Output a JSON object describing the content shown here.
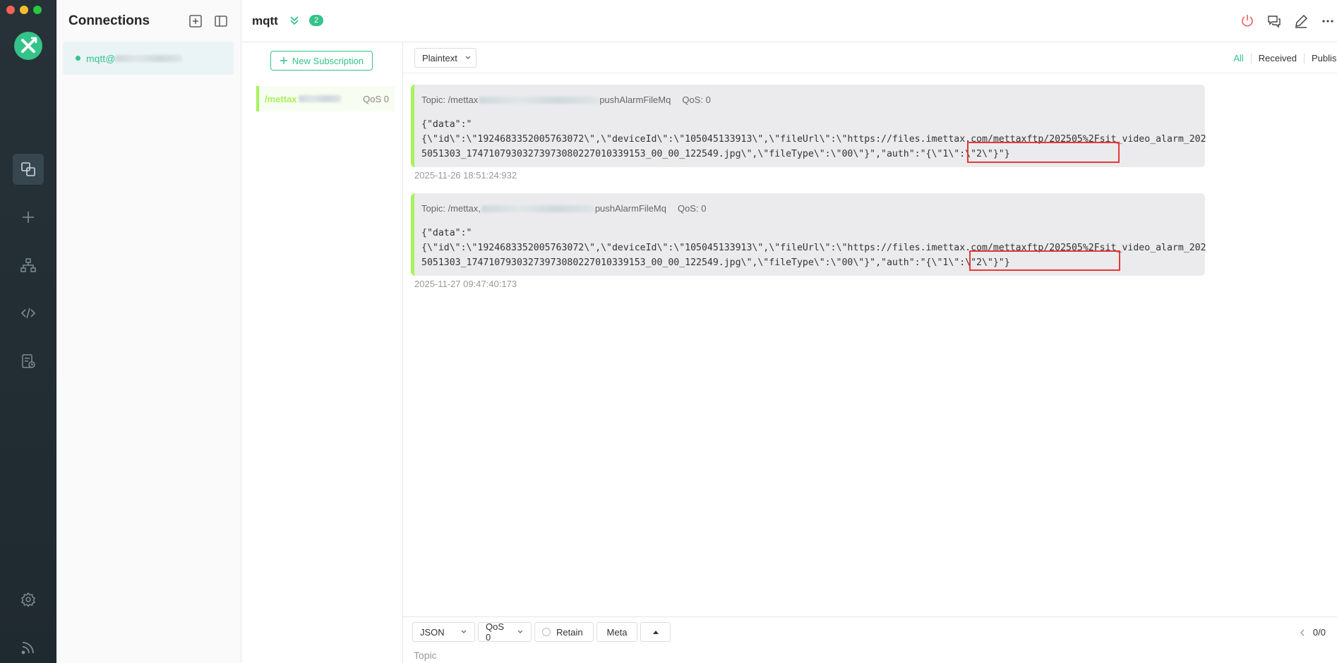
{
  "window": {
    "traffic_lights": [
      "#fe5f57",
      "#febc2e",
      "#28c840"
    ]
  },
  "colors": {
    "accent": "#34c388",
    "topic_color": "#a7f25a",
    "highlight": "#e53935"
  },
  "rail": {
    "items": [
      {
        "icon": "connections-icon",
        "active": true
      },
      {
        "icon": "plus-icon",
        "active": false
      },
      {
        "icon": "topology-icon",
        "active": false
      },
      {
        "icon": "code-icon",
        "active": false
      },
      {
        "icon": "log-icon",
        "active": false
      }
    ],
    "bottom": [
      {
        "icon": "gear-icon"
      },
      {
        "icon": "feed-icon"
      }
    ]
  },
  "connections": {
    "title": "Connections",
    "items": [
      {
        "name": "mqtt@",
        "status": "connected"
      }
    ]
  },
  "header": {
    "title": "mqtt",
    "badge": "2",
    "actions": [
      "power-icon",
      "chat-icon",
      "edit-icon",
      "more-icon"
    ]
  },
  "subscriptions": {
    "new_button": "New Subscription",
    "items": [
      {
        "topic": "/mettax",
        "qos": "QoS 0"
      }
    ]
  },
  "toolbar": {
    "format": "Plaintext",
    "filters": [
      "All",
      "Received",
      "Published"
    ],
    "active_filter": "All"
  },
  "messages": [
    {
      "topic_prefix": "Topic: /mettax",
      "topic_suffix": "pushAlarmFileMq",
      "qos": "QoS: 0",
      "payload": "{\"data\":\"\n{\\\"id\\\":\\\"1924683352005763072\\\",\\\"deviceId\\\":\\\"105045133913\\\",\\\"fileUrl\\\":\\\"https://files.imettax.com/mettaxftp/202505%2Fsit_video_alarm_2025051303_17471079303273973080227010339153_00_00_122549.jpg\\\",\\\"fileType\\\":\\\"00\\\"}\",\"auth\":\"{\\\"1\\\":\\\"2\\\"}\"}",
      "time": "2025-11-26 18:51:24:932"
    },
    {
      "topic_prefix": "Topic: /mettax,",
      "topic_suffix": "pushAlarmFileMq",
      "qos": "QoS: 0",
      "payload": "{\"data\":\"\n{\\\"id\\\":\\\"1924683352005763072\\\",\\\"deviceId\\\":\\\"105045133913\\\",\\\"fileUrl\\\":\\\"https://files.imettax.com/mettaxftp/202505%2Fsit_video_alarm_2025051303_17471079303273973080227010339153_00_00_122549.jpg\\\",\\\"fileType\\\":\\\"00\\\"}\",\"auth\":\"{\\\"1\\\":\\\"2\\\"}\"}",
      "time": "2025-11-27 09:47:40:173"
    }
  ],
  "composer": {
    "format": "JSON",
    "qos": "QoS 0",
    "retain": "Retain",
    "meta": "Meta",
    "pager": "0/0",
    "topic_placeholder": "Topic"
  }
}
